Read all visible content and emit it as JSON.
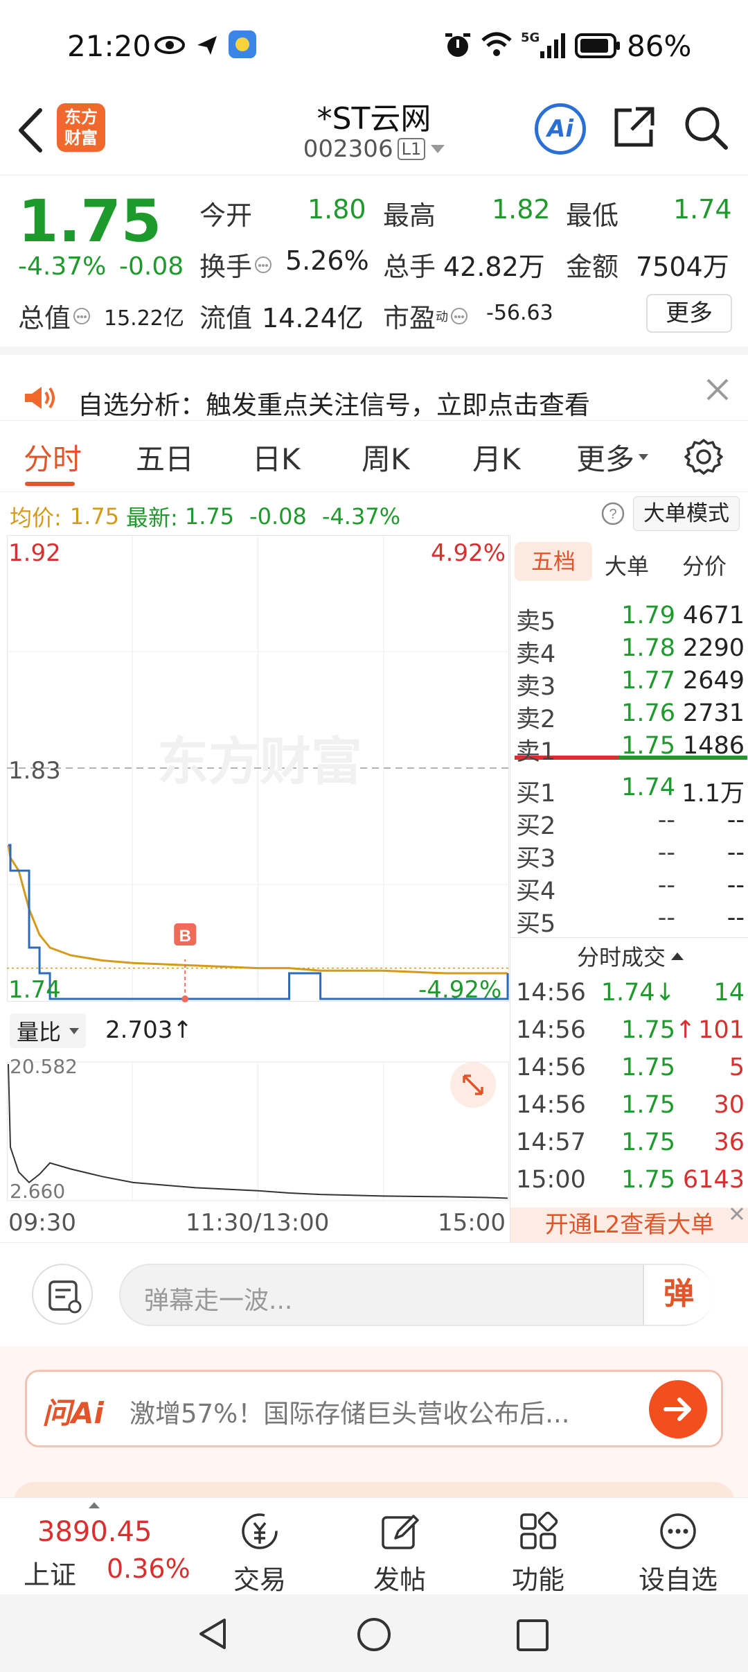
{
  "status_bar": {
    "time": "21:20",
    "network": "5G",
    "battery": "86%"
  },
  "header": {
    "logo_line1": "东方",
    "logo_line2": "财富",
    "stock_name": "*ST云网",
    "stock_code": "002306",
    "level_badge": "L1",
    "ai_label": "Ai"
  },
  "quote": {
    "price": "1.75",
    "change_pct": "-4.37%",
    "change": "-0.08",
    "open_label": "今开",
    "open": "1.80",
    "high_label": "最高",
    "high": "1.82",
    "low_label": "最低",
    "low": "1.74",
    "turnover_label": "换手",
    "turnover": "5.26%",
    "volume_label": "总手",
    "volume": "42.82万",
    "amount_label": "金额",
    "amount": "7504万",
    "mktcap_label": "总值",
    "mktcap": "15.22亿",
    "float_label": "流值",
    "float": "14.24亿",
    "pe_label": "市盈",
    "pe_sup": "动",
    "pe": "-56.63",
    "more_button": "更多"
  },
  "banner": {
    "text": "自选分析：触发重点关注信号，立即点击查看"
  },
  "tabs": [
    "分时",
    "五日",
    "日K",
    "周K",
    "月K",
    "更多"
  ],
  "info_line": {
    "avg_label": "均价:",
    "avg": "1.75",
    "latest_label": "最新:",
    "latest": "1.75",
    "change": "-0.08",
    "change_pct": "-4.37%",
    "mode_button": "大单模式"
  },
  "chart": {
    "y_top": "1.92",
    "y_top_pct": "4.92%",
    "y_mid": "1.83",
    "y_bottom": "1.74",
    "y_bottom_pct": "-4.92%",
    "watermark": "东方财富",
    "marker": "B",
    "vol_ratio_label": "量比",
    "vol_ratio": "2.703↑",
    "vol_top": "20.582",
    "vol_bottom": "2.660",
    "time_start": "09:30",
    "time_mid": "11:30/13:00",
    "time_end": "15:00"
  },
  "chart_data": {
    "type": "line",
    "title": "",
    "xlabel": "",
    "ylabel": "",
    "ylim": [
      1.74,
      1.92
    ],
    "x": [
      "09:30",
      "09:31",
      "09:35",
      "09:40",
      "09:45",
      "09:50",
      "10:00",
      "10:15",
      "10:30",
      "11:00",
      "11:30",
      "13:15",
      "13:30",
      "14:00",
      "14:30",
      "14:50",
      "15:00"
    ],
    "series": [
      {
        "values": [
          1.8,
          1.79,
          1.79,
          1.76,
          1.75,
          1.74,
          1.74,
          1.74,
          1.74,
          1.74,
          1.74,
          1.75,
          1.74,
          1.74,
          1.74,
          1.74,
          1.75
        ]
      },
      {
        "values": [
          1.8,
          1.795,
          1.79,
          1.775,
          1.765,
          1.76,
          1.757,
          1.755,
          1.754,
          1.753,
          1.752,
          1.752,
          1.751,
          1.751,
          1.75,
          1.75,
          1.75
        ]
      }
    ],
    "volume_ratio": {
      "ylim": [
        2.66,
        20.582
      ],
      "values": [
        20.582,
        9.5,
        6.2,
        4.8,
        5.9,
        7.4,
        6.6,
        5.6,
        4.8,
        4.1,
        3.7,
        3.4,
        3.2,
        3.0,
        2.9,
        2.8,
        2.703
      ]
    }
  },
  "order_book": {
    "tabs": [
      "五档",
      "大单",
      "分价"
    ],
    "asks": [
      {
        "label": "卖5",
        "price": "1.79",
        "vol": "4671"
      },
      {
        "label": "卖4",
        "price": "1.78",
        "vol": "2290"
      },
      {
        "label": "卖3",
        "price": "1.77",
        "vol": "2649"
      },
      {
        "label": "卖2",
        "price": "1.76",
        "vol": "2731"
      },
      {
        "label": "卖1",
        "price": "1.75",
        "vol": "1486"
      }
    ],
    "bids": [
      {
        "label": "买1",
        "price": "1.74",
        "vol": "1.1万"
      },
      {
        "label": "买2",
        "price": "--",
        "vol": "--"
      },
      {
        "label": "买3",
        "price": "--",
        "vol": "--"
      },
      {
        "label": "买4",
        "price": "--",
        "vol": "--"
      },
      {
        "label": "买5",
        "price": "--",
        "vol": "--"
      }
    ],
    "trades_title": "分时成交",
    "trades": [
      {
        "time": "14:56",
        "price": "1.74↓",
        "vol": "14"
      },
      {
        "time": "14:56",
        "price": "1.75↑",
        "vol": "101"
      },
      {
        "time": "14:56",
        "price": "1.75",
        "vol": "5"
      },
      {
        "time": "14:56",
        "price": "1.75",
        "vol": "30"
      },
      {
        "time": "14:57",
        "price": "1.75",
        "vol": "36"
      },
      {
        "time": "15:00",
        "price": "1.75",
        "vol": "6143"
      }
    ],
    "l2_button": "开通L2查看大单"
  },
  "comment_bar": {
    "placeholder": "弹幕走一波...",
    "send_label": "弹"
  },
  "ai_bar": {
    "brand": "问Ai",
    "text": "激增57%！国际存储巨头营收公布后..."
  },
  "bottom_nav": {
    "index_value": "3890.45",
    "index_name": "上证",
    "index_pct": "0.36%",
    "items": [
      "交易",
      "发帖",
      "功能",
      "设自选"
    ]
  },
  "colors": {
    "up": "#d8302f",
    "down": "#1e9a2c",
    "avg_line": "#d49a18",
    "price_line": "#2b6bb8",
    "accent": "#f0682b"
  }
}
